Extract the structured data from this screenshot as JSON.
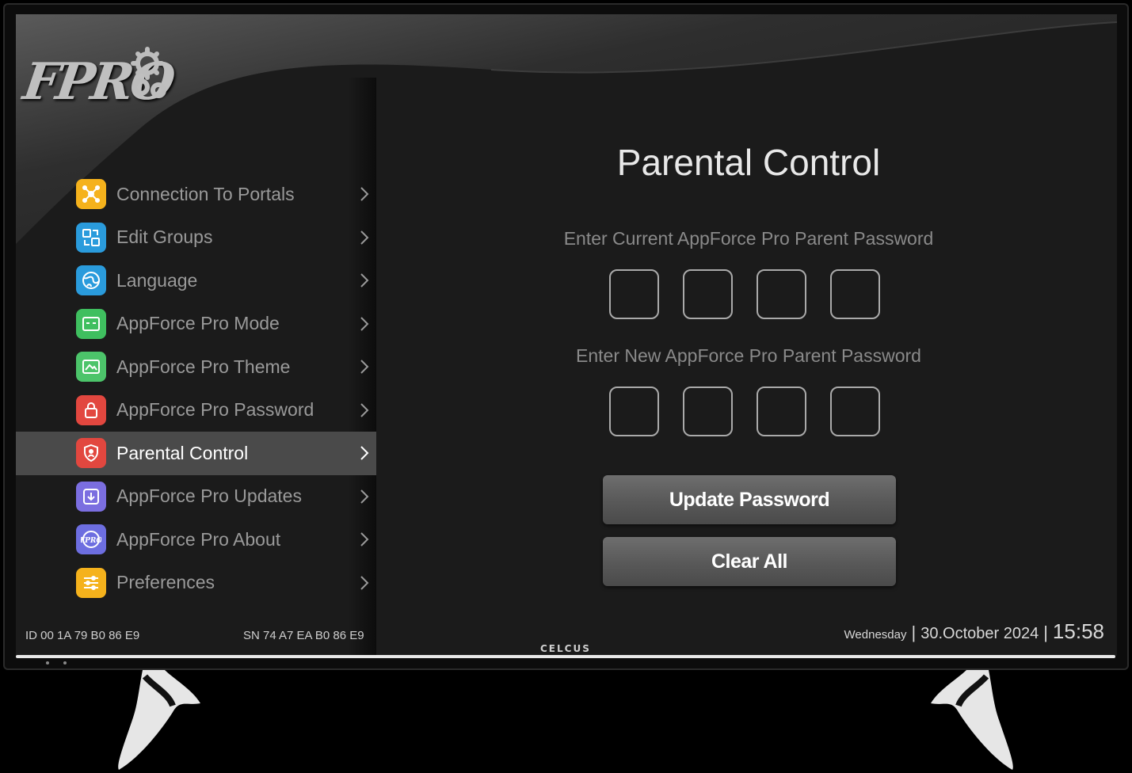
{
  "logo": {
    "text": "FPRO"
  },
  "menu": [
    {
      "label": "Connection To Portals",
      "icon": "network-icon",
      "color": "#f5b21c",
      "active": false
    },
    {
      "label": "Edit Groups",
      "icon": "groups-icon",
      "color": "#2a9bdc",
      "active": false
    },
    {
      "label": "Language",
      "icon": "globe-icon",
      "color": "#2a9bdc",
      "active": false
    },
    {
      "label": "AppForce Pro Mode",
      "icon": "mode-icon",
      "color": "#3fbf5f",
      "active": false
    },
    {
      "label": "AppForce Pro Theme",
      "icon": "theme-icon",
      "color": "#4cc46a",
      "active": false
    },
    {
      "label": "AppForce Pro Password",
      "icon": "lock-icon",
      "color": "#e2473f",
      "active": false
    },
    {
      "label": "Parental Control",
      "icon": "shield-icon",
      "color": "#e2473f",
      "active": true
    },
    {
      "label": "AppForce Pro Updates",
      "icon": "download-icon",
      "color": "#7b6ee0",
      "active": false
    },
    {
      "label": "AppForce Pro About",
      "icon": "about-icon",
      "color": "#6d6ee0",
      "active": false
    },
    {
      "label": "Preferences",
      "icon": "sliders-icon",
      "color": "#f5b21c",
      "active": false
    }
  ],
  "footer": {
    "id": "ID  00 1A 79 B0 86 E9",
    "sn": "SN  74 A7 EA B0 86 E9"
  },
  "main": {
    "title": "Parental Control",
    "current_prompt": "Enter Current AppForce Pro Parent Password",
    "new_prompt": "Enter New AppForce Pro Parent Password",
    "update_button": "Update Password",
    "clear_button": "Clear All"
  },
  "status": {
    "day": "Wednesday",
    "separator": "|",
    "date": "30.October 2024",
    "time": "15:58"
  },
  "tv_brand": "CELCUS"
}
